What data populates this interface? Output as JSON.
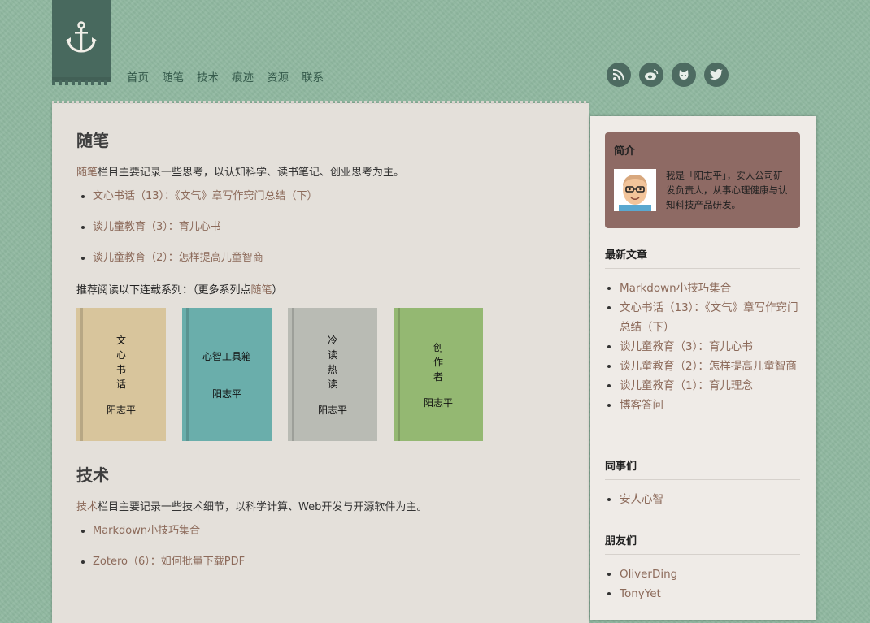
{
  "header": {
    "nav": [
      "首页",
      "随笔",
      "技术",
      "痕迹",
      "资源",
      "联系"
    ],
    "social": [
      "rss-icon",
      "weibo-icon",
      "github-icon",
      "twitter-icon"
    ]
  },
  "essay": {
    "title": "随笔",
    "desc_link": "随笔",
    "desc_text": "栏目主要记录一些思考，以认知科学、读书笔记、创业思考为主。",
    "posts": [
      "文心书话（13）：《文气》章写作窍门总结（下）",
      "谈儿童教育（3）：育儿心书",
      "谈儿童教育（2）：怎样提高儿童智商"
    ],
    "recommend_prefix": "推荐阅读以下连载系列：（更多系列点",
    "recommend_link": "随笔",
    "recommend_suffix": "）",
    "books": [
      {
        "title": [
          "文",
          "心",
          "书",
          "话"
        ],
        "author": "阳志平",
        "color": "#d8c59c"
      },
      {
        "title": [
          "心智工具箱"
        ],
        "author": "阳志平",
        "color": "#6aaeab"
      },
      {
        "title": [
          "冷",
          "读",
          "热",
          "读"
        ],
        "author": "阳志平",
        "color": "#b9bbb4"
      },
      {
        "title": [
          "创",
          "作",
          "者"
        ],
        "author": "阳志平",
        "color": "#94b872"
      }
    ]
  },
  "tech": {
    "title": "技术",
    "desc_link": "技术",
    "desc_text": "栏目主要记录一些技术细节，以科学计算、Web开发与开源软件为主。",
    "posts": [
      "Markdown小技巧集合",
      "Zotero（6）：如何批量下载PDF"
    ]
  },
  "sidebar": {
    "intro": {
      "title": "简介",
      "text": "我是「阳志平」，安人公司研发负责人，从事心理健康与认知科技产品研发。"
    },
    "recent": {
      "title": "最新文章",
      "items": [
        "Markdown小技巧集合",
        "文心书话（13）：《文气》章写作窍门总结（下）",
        "谈儿童教育（3）：育儿心书",
        "谈儿童教育（2）：怎样提高儿童智商",
        "谈儿童教育（1）：育儿理念",
        "博客答问"
      ]
    },
    "colleagues": {
      "title": "同事们",
      "items": [
        "安人心智"
      ]
    },
    "friends": {
      "title": "朋友们",
      "items": [
        "OliverDing",
        "TonyYet"
      ]
    }
  }
}
